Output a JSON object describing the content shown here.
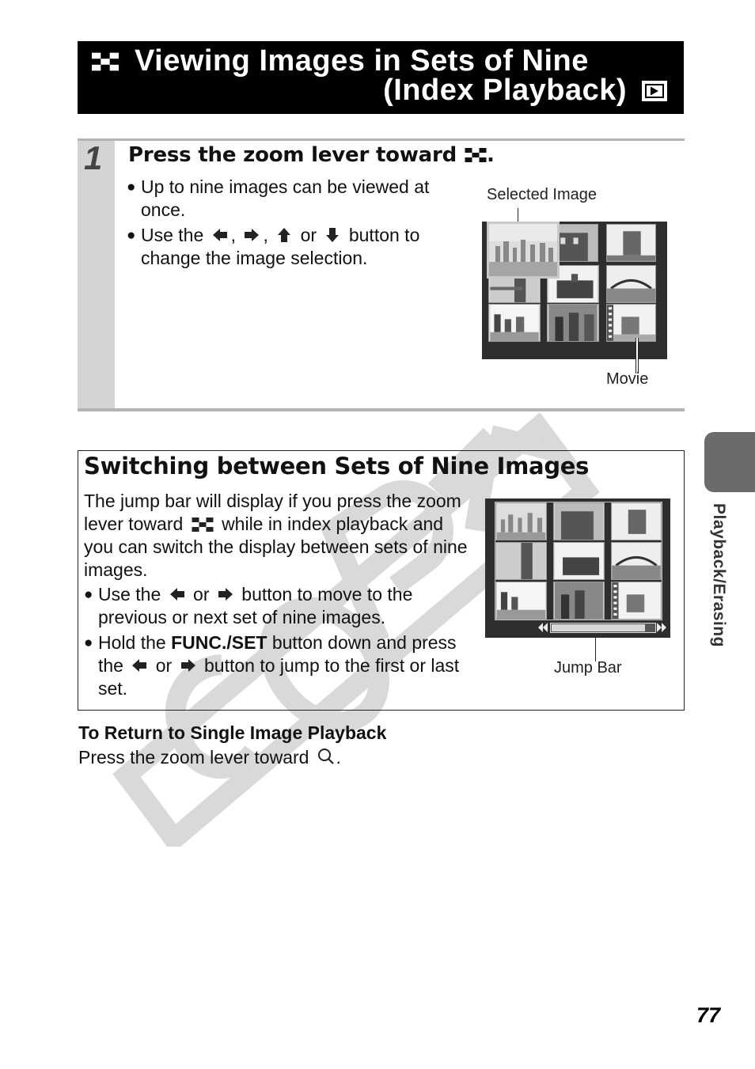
{
  "header": {
    "title_line1": "Viewing Images in Sets of Nine",
    "title_line2": "(Index Playback)",
    "icons": [
      "index-icon",
      "playback-mode-icon"
    ]
  },
  "step1": {
    "number": "1",
    "title": "Press the zoom lever toward",
    "title_end": ".",
    "bullets": [
      "Up to nine images can be viewed at once.",
      {
        "pre": "Use the",
        "sep1": ",",
        "sep2": ",",
        "or": "or",
        "post": "button to change the image selection."
      }
    ],
    "figure": {
      "labels": {
        "selected": "Selected Image",
        "movie": "Movie"
      }
    }
  },
  "section": {
    "title": "Switching between Sets of Nine Images",
    "paragraph_pre": "The jump bar will display if you press the zoom lever toward",
    "paragraph_post": "while in index playback and you can switch the display between sets of nine images.",
    "bullet1": {
      "pre": "Use the",
      "or": "or",
      "post": "button to move to the previous or next set of nine images."
    },
    "bullet2": {
      "pre": "Hold the",
      "bold": "FUNC./SET",
      "mid": "button down and press the",
      "or": "or",
      "post": "button to jump to the first or last set."
    },
    "figure": {
      "label": "Jump Bar"
    }
  },
  "return": {
    "title": "To Return to Single Image Playback",
    "text": "Press the zoom lever toward",
    "text_end": "."
  },
  "side_tab": {
    "label": "Playback/Erasing"
  },
  "page_number": "77",
  "watermark": "COPY"
}
